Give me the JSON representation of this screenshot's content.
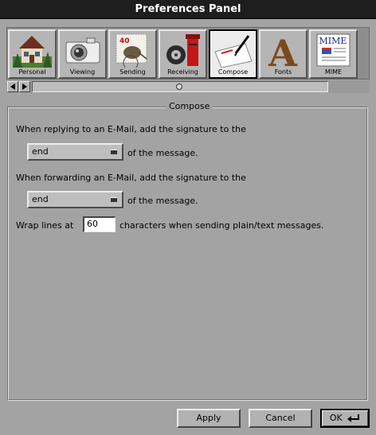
{
  "window": {
    "title": "Preferences Panel"
  },
  "toolbar": {
    "items": [
      {
        "label": "Personal",
        "icon": "house-icon"
      },
      {
        "label": "Viewing",
        "icon": "camera-icon"
      },
      {
        "label": "Sending",
        "icon": "stamp-icon",
        "stamp_text": "40"
      },
      {
        "label": "Receiving",
        "icon": "mailbox-icon"
      },
      {
        "label": "Compose",
        "icon": "pen-paper-icon",
        "active": true
      },
      {
        "label": "Fonts",
        "icon": "font-letter-icon",
        "glyph": "A"
      },
      {
        "label": "MIME",
        "icon": "mime-icon",
        "badge": "MIME"
      }
    ]
  },
  "compose": {
    "section_title": "Compose",
    "reply_text": "When replying to an E-Mail, add the signature to the",
    "reply_position": "end",
    "reply_suffix": "of the message.",
    "forward_text": "When forwarding an E-Mail, add the signature to the",
    "forward_position": "end",
    "forward_suffix": "of the message.",
    "wrap_prefix": "Wrap lines at",
    "wrap_value": "60",
    "wrap_suffix": "characters when sending plain/text messages."
  },
  "buttons": {
    "apply": "Apply",
    "cancel": "Cancel",
    "ok": "OK"
  }
}
